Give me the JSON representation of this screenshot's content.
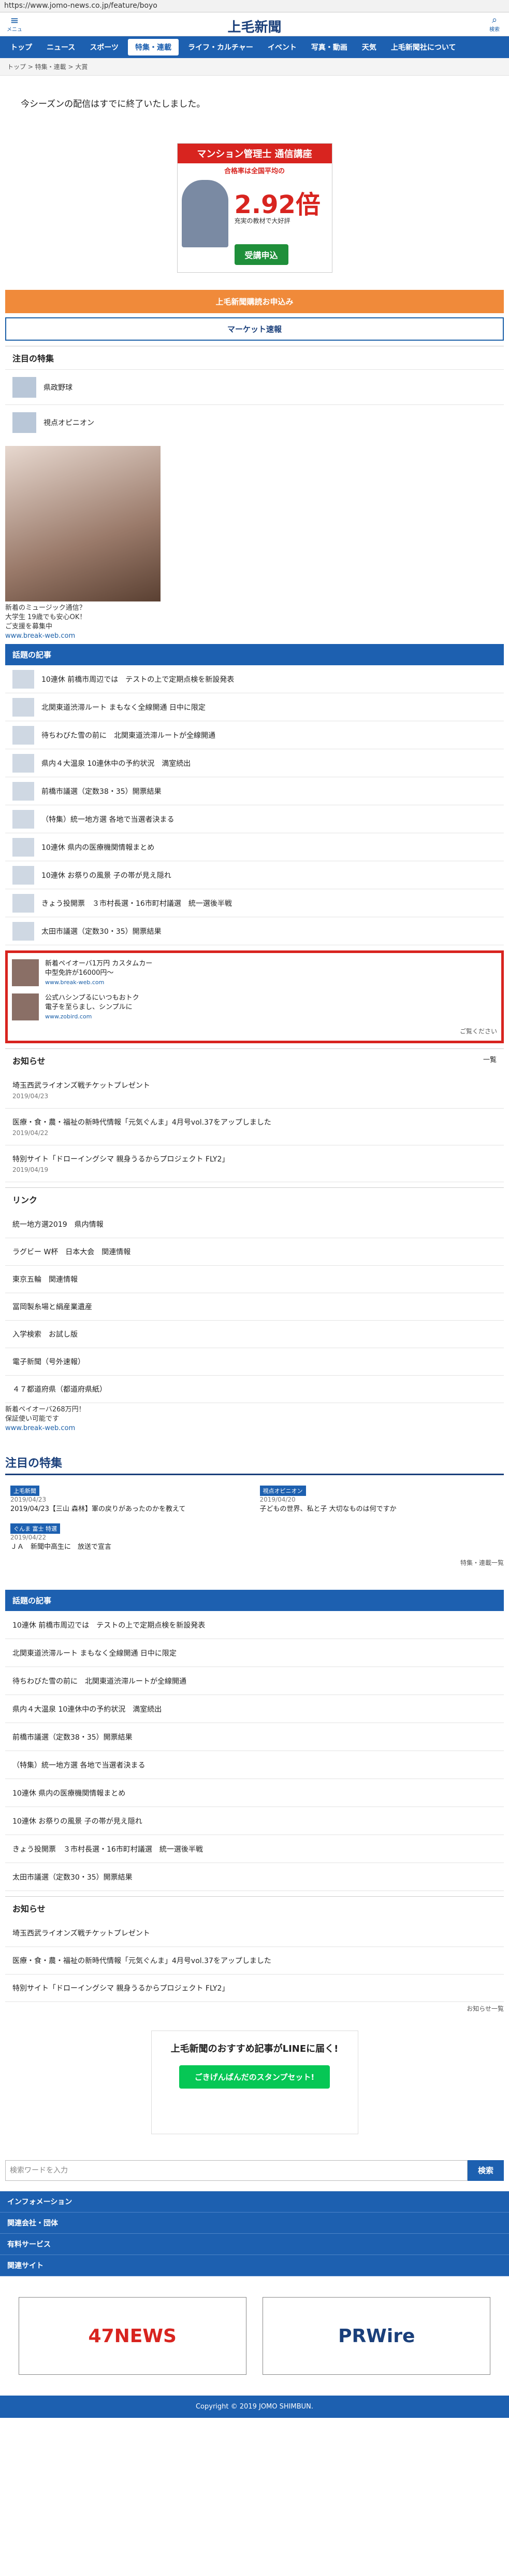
{
  "browser": {
    "url": "https://www.jomo-news.co.jp/feature/boyo"
  },
  "header": {
    "menu_label": "メニュー",
    "logo": "上毛新聞",
    "search_label": "検索"
  },
  "nav": [
    "トップ",
    "ニュース",
    "スポーツ",
    "特集・連載",
    "ライフ・カルチャー",
    "イベント",
    "写真・動画",
    "天気",
    "上毛新聞社について"
  ],
  "breadcrumb": "トップ > 特集・連載 > 大賞",
  "notice": "今シーズンの配信はすでに終了いたしました。",
  "ad": {
    "top": "マンション管理士 通信講座",
    "sub": "合格率は全国平均の",
    "big": "2.92倍",
    "cap": "充実の教材で大好評",
    "cta": "受講申込"
  },
  "buttons": {
    "subscribe": "上毛新聞購読お申込み",
    "market": "マーケット速報"
  },
  "featured": {
    "title": "注目の特集",
    "items": [
      "県政野球",
      "視点オピニオン"
    ]
  },
  "promo": {
    "line1": "新着のミュージック通信？",
    "line2": "大学生 19歳でも安心OK！",
    "line3": "ご支援を募集中",
    "url": "www.break-web.com"
  },
  "ranking": {
    "title": "話題の記事",
    "items": [
      "10連休 前橋市周辺では　テストの上で定期点検を新設発表",
      "北関東道渋滞ルート まもなく全線開通 日中に限定",
      "待ちわびた雪の前に　北関東道渋滞ルートが全線開通",
      "県内４大温泉 10連休中の予約状況　満室続出",
      "前橋市議選（定数38・35）開票結果",
      "（特集）統一地方選 各地で当選者決まる",
      "10連休 県内の医療機関情報まとめ",
      "10連休 お祭りの風景 子の帯が見え隠れ",
      "きょう投開票　３市村長選・16市町村議選　統一選後半戦",
      "太田市議選（定数30・35）開票結果"
    ]
  },
  "red_ads": [
    {
      "title": "新着ペイオーバ1万円 カスタムカー",
      "desc": "中型免許が16000円〜",
      "url": "www.break-web.com"
    },
    {
      "title": "公式ハシンプるにいつもおトク",
      "desc": "電子を至らまし、シンプルに",
      "url": "www.zobird.com"
    }
  ],
  "more_label": "ご覧ください",
  "news": {
    "title": "お知らせ",
    "list_link": "一覧",
    "items": [
      {
        "text": "埼玉西武ライオンズ戦チケットプレゼント",
        "date": "2019/04/23"
      },
      {
        "text": "医療・食・農・福祉の新時代情報「元気ぐんま」4月号vol.37をアップしました",
        "date": "2019/04/22"
      },
      {
        "text": "特別サイト「ドローイングシマ 親身うるからプロジェクト FLY2」",
        "date": "2019/04/19"
      }
    ]
  },
  "links": {
    "title": "リンク",
    "items": [
      "統一地方選2019　県内情報",
      "ラグビー W杯　日本大会　関連情報",
      "東京五輪　関連情報",
      "冨岡製糸場と絹産業遺産",
      "入学検索　お試し版",
      "電子新聞（号外速報）",
      "４７都道府県（都道府県紙）"
    ]
  },
  "links_ad": {
    "line1": "新着ペイオーバ268万円！",
    "line2": "保証使い可能です",
    "url": "www.break-web.com"
  },
  "feature_big": {
    "title": "注目の特集",
    "col1": {
      "tag": "上毛新聞",
      "date": "2019/04/23",
      "text": "2019/04/23【三山 森林】軍の戻りがあったのかを教えて"
    },
    "col2": {
      "tag": "視点オピニオン",
      "date": "2019/04/20",
      "text": "子どもの世界、私と子 大切なものは何ですか"
    },
    "col3": {
      "tag": "ぐんま 富士 特選",
      "date": "2019/04/22",
      "text": "ＪＡ　新聞中高生に　放送で宣言"
    },
    "more": "特集・連載一覧"
  },
  "ranking2": {
    "title": "話題の記事"
  },
  "news2": {
    "title": "お知らせ",
    "list_link": "お知らせ一覧"
  },
  "line": {
    "text": "上毛新聞のおすすめ記事がLINEに届く!",
    "btn": "ごきげんぱんだのスタンプセット!"
  },
  "search": {
    "placeholder": "検索ワードを入力",
    "btn": "検索"
  },
  "footer": {
    "bars": [
      "インフォメーション",
      "関連会社・団体",
      "有料サービス",
      "関連サイト"
    ],
    "banner1": "47NEWS",
    "banner2": "PRWire",
    "copyright": "Copyright © 2019 JOMO SHIMBUN."
  }
}
